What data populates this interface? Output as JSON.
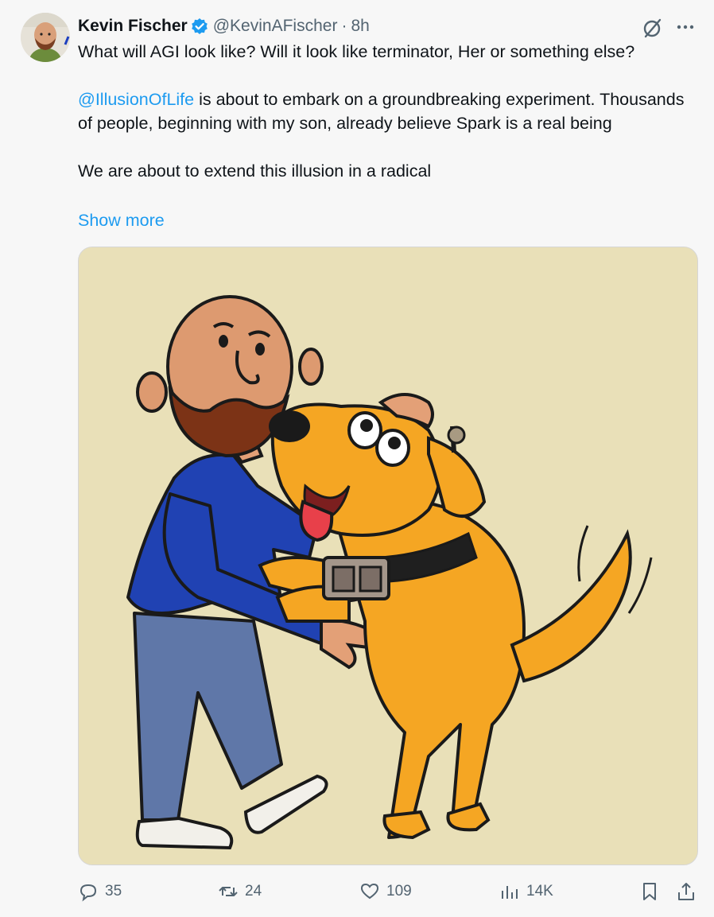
{
  "author": {
    "name": "Kevin Fischer",
    "handle": "@KevinAFischer",
    "separator": "·",
    "time": "8h",
    "verified_color": "#1d9bf0"
  },
  "header_icons": {
    "grok": "grok-icon",
    "more": "more-icon"
  },
  "body": {
    "line1": "What will AGI look like? Will it look like terminator, Her or something else?",
    "mention": "@IllusionOfLife",
    "line2_rest": " is about to embark on a groundbreaking experiment. Thousands of people, beginning with my son, already believe Spark is a real being",
    "line3": "We are about to extend this illusion in a radical",
    "show_more": "Show more"
  },
  "media": {
    "icon": "illustration-man-hugging-robot-dog",
    "background_color": "#e9e0b8"
  },
  "actions": {
    "replies": "35",
    "reposts": "24",
    "likes": "109",
    "views": "14K",
    "bookmark": "bookmark-icon",
    "share": "share-icon"
  },
  "colors": {
    "accent": "#1d9bf0",
    "muted": "#536471",
    "text": "#0f1419"
  }
}
